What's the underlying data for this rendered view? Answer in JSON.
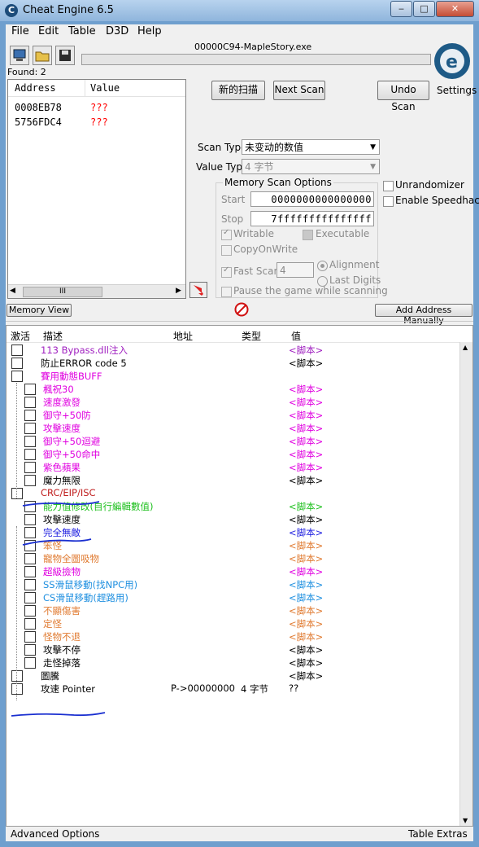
{
  "window": {
    "title": "Cheat Engine 6.5",
    "minimize": "‒",
    "maximize": "□",
    "close": "✕"
  },
  "menu": [
    "File",
    "Edit",
    "Table",
    "D3D",
    "Help"
  ],
  "process_label": "00000C94-MapleStory.exe",
  "found_label": "Found: 2",
  "settings_label": "Settings",
  "found_list": {
    "headers": [
      "Address",
      "Value"
    ],
    "rows": [
      {
        "address": "0008EB78",
        "value": "???"
      },
      {
        "address": "5756FDC4",
        "value": "???"
      }
    ],
    "scroll_thumb": "III"
  },
  "buttons": {
    "first_scan": "新的扫描",
    "next_scan": "Next Scan",
    "undo_scan": "Undo Scan",
    "memory_view": "Memory View",
    "add_address": "Add Address Manually"
  },
  "scan_type": {
    "label": "Scan Type",
    "value": "未变动的数值"
  },
  "value_type": {
    "label": "Value Type",
    "value": "4 字节"
  },
  "memory_options": {
    "title": "Memory Scan Options",
    "start_label": "Start",
    "start_value": "0000000000000000",
    "stop_label": "Stop",
    "stop_value": "7fffffffffffffff",
    "writable": "Writable",
    "executable": "Executable",
    "copy_on_write": "CopyOnWrite",
    "fast_scan": "Fast Scan",
    "fast_scan_value": "4",
    "alignment": "Alignment",
    "last_digits": "Last Digits",
    "pause": "Pause the game while scanning"
  },
  "unrandomizer": "Unrandomizer",
  "speedhack": "Enable Speedhack",
  "table": {
    "headers": [
      "激活",
      "描述",
      "地址",
      "类型",
      "值"
    ],
    "rows": [
      {
        "desc": "113 Bypass.dll注入",
        "val": "<脚本>",
        "color": "#a020c0",
        "indent": 0
      },
      {
        "desc": "防止ERROR code 5",
        "val": "<脚本>",
        "color": "#000000",
        "indent": 0
      },
      {
        "desc": "賽用動態BUFF",
        "val": "",
        "color": "#e000e0",
        "indent": 0
      },
      {
        "desc": "楓祝30",
        "val": "<脚本>",
        "color": "#e000e0",
        "indent": 1
      },
      {
        "desc": "速度激發",
        "val": "<脚本>",
        "color": "#e000e0",
        "indent": 1
      },
      {
        "desc": "御守+50防",
        "val": "<脚本>",
        "color": "#e000e0",
        "indent": 1
      },
      {
        "desc": "攻擊速度",
        "val": "<脚本>",
        "color": "#e000e0",
        "indent": 1
      },
      {
        "desc": "御守+50迴避",
        "val": "<脚本>",
        "color": "#e000e0",
        "indent": 1
      },
      {
        "desc": "御守+50命中",
        "val": "<脚本>",
        "color": "#e000e0",
        "indent": 1
      },
      {
        "desc": "紫色蘋果",
        "val": "<脚本>",
        "color": "#e000e0",
        "indent": 1
      },
      {
        "desc": "魔力無限",
        "val": "<脚本>",
        "color": "#000000",
        "indent": 1
      },
      {
        "desc": "CRC/EIP/ISC",
        "val": "",
        "color": "#c02020",
        "indent": 0
      },
      {
        "desc": "能力值修改(自行編輯數值)",
        "val": "<脚本>",
        "color": "#20c020",
        "indent": 1
      },
      {
        "desc": "攻擊速度",
        "val": "<脚本>",
        "color": "#000000",
        "indent": 1
      },
      {
        "desc": "完全無敵",
        "val": "<脚本>",
        "color": "#2020e0",
        "indent": 1
      },
      {
        "desc": "笨怪",
        "val": "<脚本>",
        "color": "#e07a30",
        "indent": 1
      },
      {
        "desc": "寵物全圖吸物",
        "val": "<脚本>",
        "color": "#e07a30",
        "indent": 1
      },
      {
        "desc": "超級撿物",
        "val": "<脚本>",
        "color": "#e000e0",
        "indent": 1
      },
      {
        "desc": "SS滑鼠移動(找NPC用)",
        "val": "<脚本>",
        "color": "#2090e0",
        "indent": 1
      },
      {
        "desc": "CS滑鼠移動(趕路用)",
        "val": "<脚本>",
        "color": "#2090e0",
        "indent": 1
      },
      {
        "desc": "不顯傷害",
        "val": "<脚本>",
        "color": "#e07a30",
        "indent": 1
      },
      {
        "desc": "定怪",
        "val": "<脚本>",
        "color": "#e07a30",
        "indent": 1
      },
      {
        "desc": "怪物不退",
        "val": "<脚本>",
        "color": "#e07a30",
        "indent": 1
      },
      {
        "desc": "攻擊不停",
        "val": "<脚本>",
        "color": "#000000",
        "indent": 1
      },
      {
        "desc": "走怪掉落",
        "val": "<脚本>",
        "color": "#000000",
        "indent": 1
      },
      {
        "desc": "圖騰",
        "val": "<脚本>",
        "color": "#000000",
        "indent": 0
      },
      {
        "desc": "攻速 Pointer",
        "addr": "P->00000000",
        "type": "4 字节",
        "val": "??",
        "color": "#000000",
        "indent": 0
      }
    ]
  },
  "status": {
    "left": "Advanced Options",
    "right": "Table Extras"
  },
  "colors": {
    "red_value": "#ff0000",
    "scribble": "#1a2fd0"
  }
}
